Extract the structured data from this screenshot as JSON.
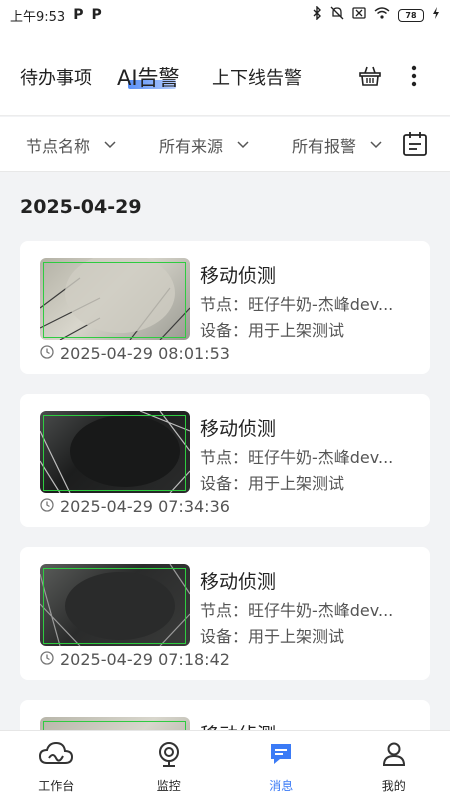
{
  "status_bar": {
    "time": "上午9:53",
    "app_badges": [
      "P",
      "P"
    ],
    "battery": "78"
  },
  "tabs": [
    {
      "label": "待办事项"
    },
    {
      "label": "AI告警",
      "active": true
    },
    {
      "label": "上下线告警"
    }
  ],
  "filters": [
    {
      "label": "节点名称"
    },
    {
      "label": "所有来源"
    },
    {
      "label": "所有报警"
    }
  ],
  "date_group": "2025-04-29",
  "alerts": [
    {
      "title": "移动侦测",
      "node": "节点：旺仔牛奶-杰峰dev...",
      "device": "设备：用于上架测试",
      "time": "2025-04-29 08:01:53",
      "thumb_color": "#c9c7bd"
    },
    {
      "title": "移动侦测",
      "node": "节点：旺仔牛奶-杰峰dev...",
      "device": "设备：用于上架测试",
      "time": "2025-04-29 07:34:36",
      "thumb_color": "#1e1f1f"
    },
    {
      "title": "移动侦测",
      "node": "节点：旺仔牛奶-杰峰dev...",
      "device": "设备：用于上架测试",
      "time": "2025-04-29 07:18:42",
      "thumb_color": "#2a2b2b"
    },
    {
      "title": "移动侦测",
      "node": "",
      "device": "",
      "time": "",
      "thumb_color": "#d0cec6"
    }
  ],
  "bottom_nav": [
    {
      "label": "工作台",
      "icon": "cloud-workbench-icon"
    },
    {
      "label": "监控",
      "icon": "camera-icon"
    },
    {
      "label": "消息",
      "icon": "message-icon",
      "active": true
    },
    {
      "label": "我的",
      "icon": "person-icon"
    }
  ],
  "colors": {
    "accent": "#3b7bf6",
    "detection_box": "#2ecc40",
    "background": "#f2f3f5"
  }
}
